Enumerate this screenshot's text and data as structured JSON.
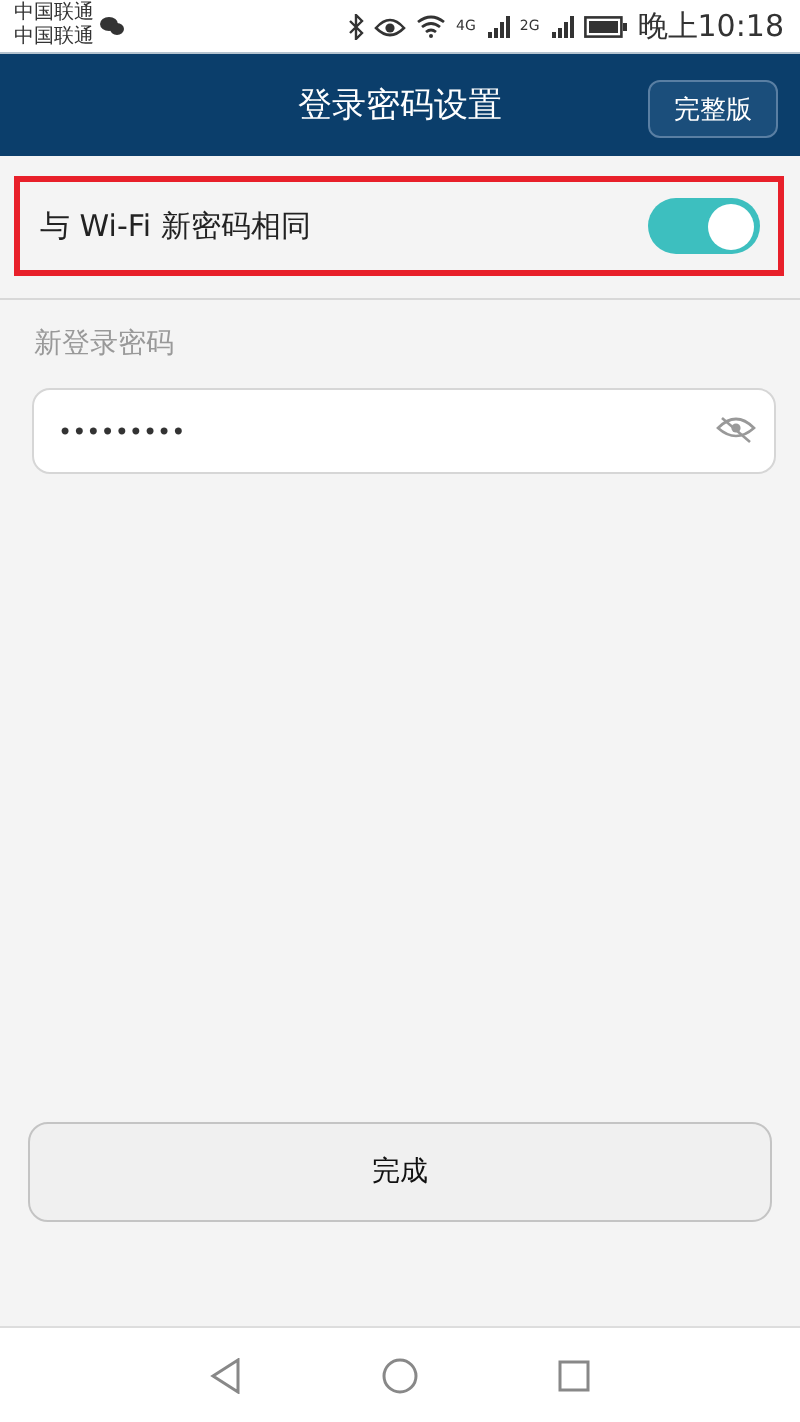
{
  "status_bar": {
    "carriers": [
      "中国联通",
      "中国联通"
    ],
    "time": "晚上10:18",
    "network_1": "4G",
    "network_2": "2G"
  },
  "header": {
    "title": "登录密码设置",
    "action": "完整版"
  },
  "same_as_wifi": {
    "label": "与 Wi-Fi 新密码相同",
    "on": true,
    "highlighted": true
  },
  "password": {
    "label": "新登录密码",
    "value": "•••••••••",
    "masked": true
  },
  "done_button": "完成"
}
